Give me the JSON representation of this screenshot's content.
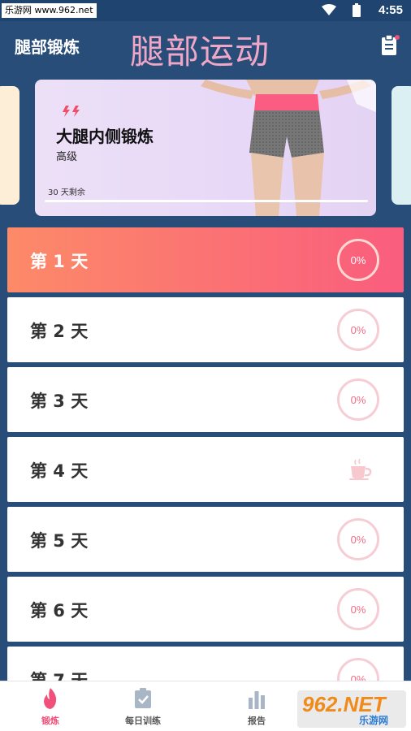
{
  "status_bar": {
    "watermark": "乐游网 www.962.net",
    "time": "4:55"
  },
  "header": {
    "title": "腿部锻炼",
    "banner": "腿部运动",
    "clipboard_icon": "clipboard-icon"
  },
  "feature_card": {
    "title": "大腿内侧锻炼",
    "level": "高级",
    "remaining": "30 天剩余",
    "progress_fraction": 0.0,
    "flash_icon": "lightning-icon"
  },
  "days": [
    {
      "label": "第 1 天",
      "progress": "0%",
      "active": true,
      "rest": false
    },
    {
      "label": "第 2 天",
      "progress": "0%",
      "active": false,
      "rest": false
    },
    {
      "label": "第 3 天",
      "progress": "0%",
      "active": false,
      "rest": false
    },
    {
      "label": "第 4 天",
      "progress": "",
      "active": false,
      "rest": true
    },
    {
      "label": "第 5 天",
      "progress": "0%",
      "active": false,
      "rest": false
    },
    {
      "label": "第 6 天",
      "progress": "0%",
      "active": false,
      "rest": false
    },
    {
      "label": "第 7 天",
      "progress": "0%",
      "active": false,
      "rest": false
    }
  ],
  "bottom_nav": [
    {
      "label": "锻炼",
      "icon": "flame-icon",
      "active": true
    },
    {
      "label": "每日训练",
      "icon": "clipboard-check-icon",
      "active": false
    },
    {
      "label": "报告",
      "icon": "bar-chart-icon",
      "active": false
    }
  ],
  "watermark": {
    "brand": "962.NET",
    "sub": "乐游网"
  },
  "colors": {
    "background": "#284d78",
    "active_gradient_start": "#fc8a68",
    "active_gradient_end": "#fa5d7e",
    "accent_pink": "#f0507a",
    "banner_pink": "#f0a7c7"
  }
}
